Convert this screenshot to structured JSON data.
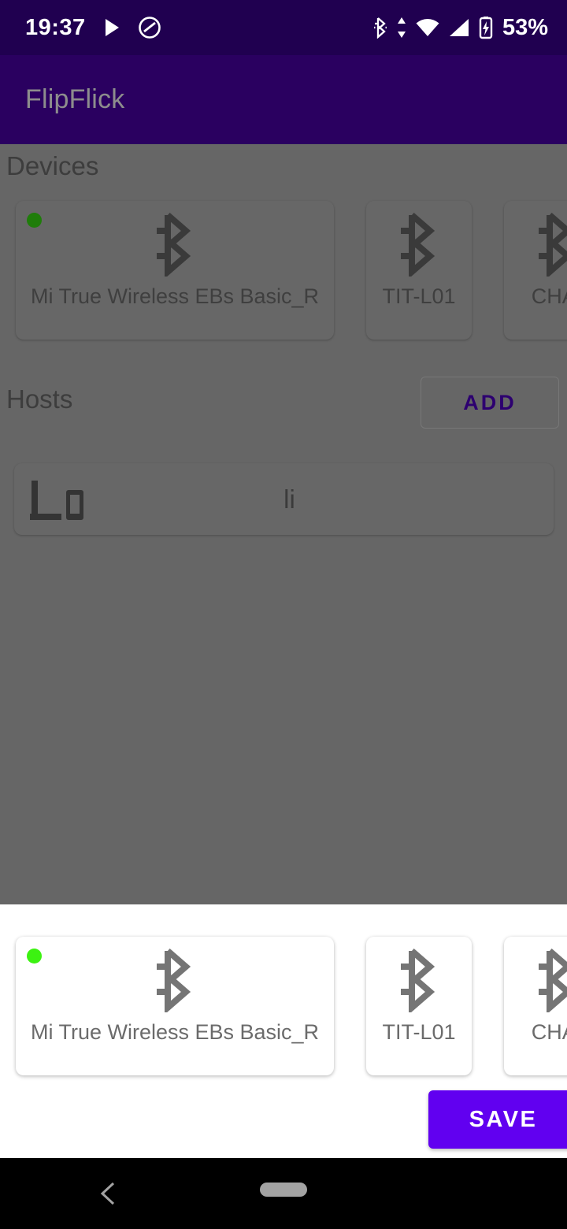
{
  "status_bar": {
    "clock": "19:37",
    "battery_percent": "53%",
    "wifi_level": "4",
    "icons": [
      "play-icon",
      "do-not-disturb-icon",
      "bluetooth-icon",
      "data-transfer-icon",
      "wifi-icon",
      "cellular-signal-icon",
      "battery-charging-icon"
    ],
    "background_color": "#200050"
  },
  "app_bar": {
    "title": "FlipFlick",
    "background_color": "#2a0060",
    "title_color": "#8d8d8d"
  },
  "content": {
    "scrim_color": "#666666",
    "devices": {
      "title": "Devices",
      "cards": [
        {
          "label": "Mi True Wireless EBs Basic_R",
          "icon": "bluetooth-icon",
          "connected": true,
          "wide": true
        },
        {
          "label": "TIT-L01",
          "icon": "bluetooth-icon",
          "connected": false,
          "wide": false
        },
        {
          "label": "CHAI",
          "icon": "bluetooth-icon",
          "connected": false,
          "wide": false
        }
      ]
    },
    "hosts": {
      "title": "Hosts",
      "add_label": "ADD",
      "add_color": "#2d0070",
      "rows": [
        {
          "label": "li",
          "icon": "devices-icon"
        }
      ]
    }
  },
  "bottom_sheet": {
    "background_color": "#ffffff",
    "cards": [
      {
        "label": "Mi True Wireless EBs Basic_R",
        "icon": "bluetooth-icon",
        "connected": true,
        "wide": true
      },
      {
        "label": "TIT-L01",
        "icon": "bluetooth-icon",
        "connected": false,
        "wide": false
      },
      {
        "label": "CHAI",
        "icon": "bluetooth-icon",
        "connected": false,
        "wide": false
      }
    ],
    "save_label": "SAVE",
    "save_color": "#6100f0",
    "connected_dot_color": "#3cf211"
  },
  "nav_bar": {
    "background_color": "#000000",
    "buttons": [
      "back-icon",
      "home-pill"
    ]
  }
}
